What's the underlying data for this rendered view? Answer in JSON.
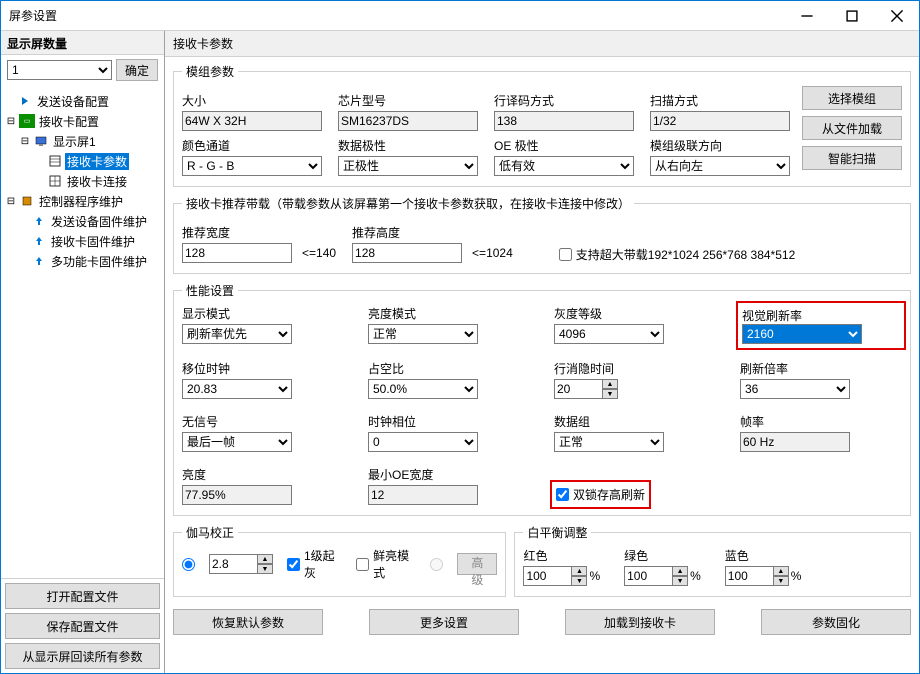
{
  "window": {
    "title": "屏参设置"
  },
  "left": {
    "count_label": "显示屏数量",
    "count_value": "1",
    "confirm": "确定",
    "tree": {
      "send_cfg": "发送设备配置",
      "recv_cfg": "接收卡配置",
      "screen1": "显示屏1",
      "recv_param": "接收卡参数",
      "recv_conn": "接收卡连接",
      "ctrl_maint": "控制器程序维护",
      "send_fw": "发送设备固件维护",
      "recv_fw": "接收卡固件维护",
      "multi_fw": "多功能卡固件维护"
    },
    "open_cfg": "打开配置文件",
    "save_cfg": "保存配置文件",
    "read_all": "从显示屏回读所有参数"
  },
  "right": {
    "title": "接收卡参数",
    "module": {
      "legend": "模组参数",
      "size_lbl": "大小",
      "size_val": "64W X 32H",
      "chip_lbl": "芯片型号",
      "chip_val": "SM16237DS",
      "decode_lbl": "行译码方式",
      "decode_val": "138",
      "scan_lbl": "扫描方式",
      "scan_val": "1/32",
      "color_lbl": "颜色通道",
      "color_val": "R - G - B",
      "polarity_lbl": "数据极性",
      "polarity_val": "正极性",
      "oe_lbl": "OE 极性",
      "oe_val": "低有效",
      "cascade_lbl": "模组级联方向",
      "cascade_val": "从右向左",
      "btn_select": "选择模组",
      "btn_loadfile": "从文件加载",
      "btn_smartscan": "智能扫描"
    },
    "capacity": {
      "legend": "接收卡推荐带载（带载参数从该屏幕第一个接收卡参数获取，在接收卡连接中修改）",
      "rec_w_lbl": "推荐宽度",
      "rec_w_val": "128",
      "rec_w_hint": "<=140",
      "rec_h_lbl": "推荐高度",
      "rec_h_val": "128",
      "rec_h_hint": "<=1024",
      "huge_chk": "支持超大带载192*1024 256*768 384*512"
    },
    "perf": {
      "legend": "性能设置",
      "disp_mode_lbl": "显示模式",
      "disp_mode_val": "刷新率优先",
      "bri_mode_lbl": "亮度模式",
      "bri_mode_val": "正常",
      "gray_lbl": "灰度等级",
      "gray_val": "4096",
      "vrefresh_lbl": "视觉刷新率",
      "vrefresh_val": "2160",
      "shift_lbl": "移位时钟",
      "shift_val": "20.83",
      "duty_lbl": "占空比",
      "duty_val": "50.0%",
      "blank_lbl": "行消隐时间",
      "blank_val": "20",
      "mult_lbl": "刷新倍率",
      "mult_val": "36",
      "nosig_lbl": "无信号",
      "nosig_val": "最后一帧",
      "phase_lbl": "时钟相位",
      "phase_val": "0",
      "datagroup_lbl": "数据组",
      "datagroup_val": "正常",
      "fps_lbl": "帧率",
      "fps_val": "60 Hz",
      "bri_lbl": "亮度",
      "bri_val": "77.95%",
      "minoe_lbl": "最小OE宽度",
      "minoe_val": "12",
      "dbllatch_chk": "双锁存高刷新"
    },
    "gamma": {
      "legend": "伽马校正",
      "value": "2.8",
      "lvl1_gray": "1级起灰",
      "vivid_mode": "鲜亮模式",
      "advanced": "高级"
    },
    "wb": {
      "legend": "白平衡调整",
      "r_lbl": "红色",
      "r_val": "100",
      "g_lbl": "绿色",
      "g_val": "100",
      "b_lbl": "蓝色",
      "b_val": "100",
      "pct": "%"
    },
    "actions": {
      "restore": "恢复默认参数",
      "more": "更多设置",
      "load_to_recv": "加载到接收卡",
      "solidify": "参数固化"
    }
  }
}
